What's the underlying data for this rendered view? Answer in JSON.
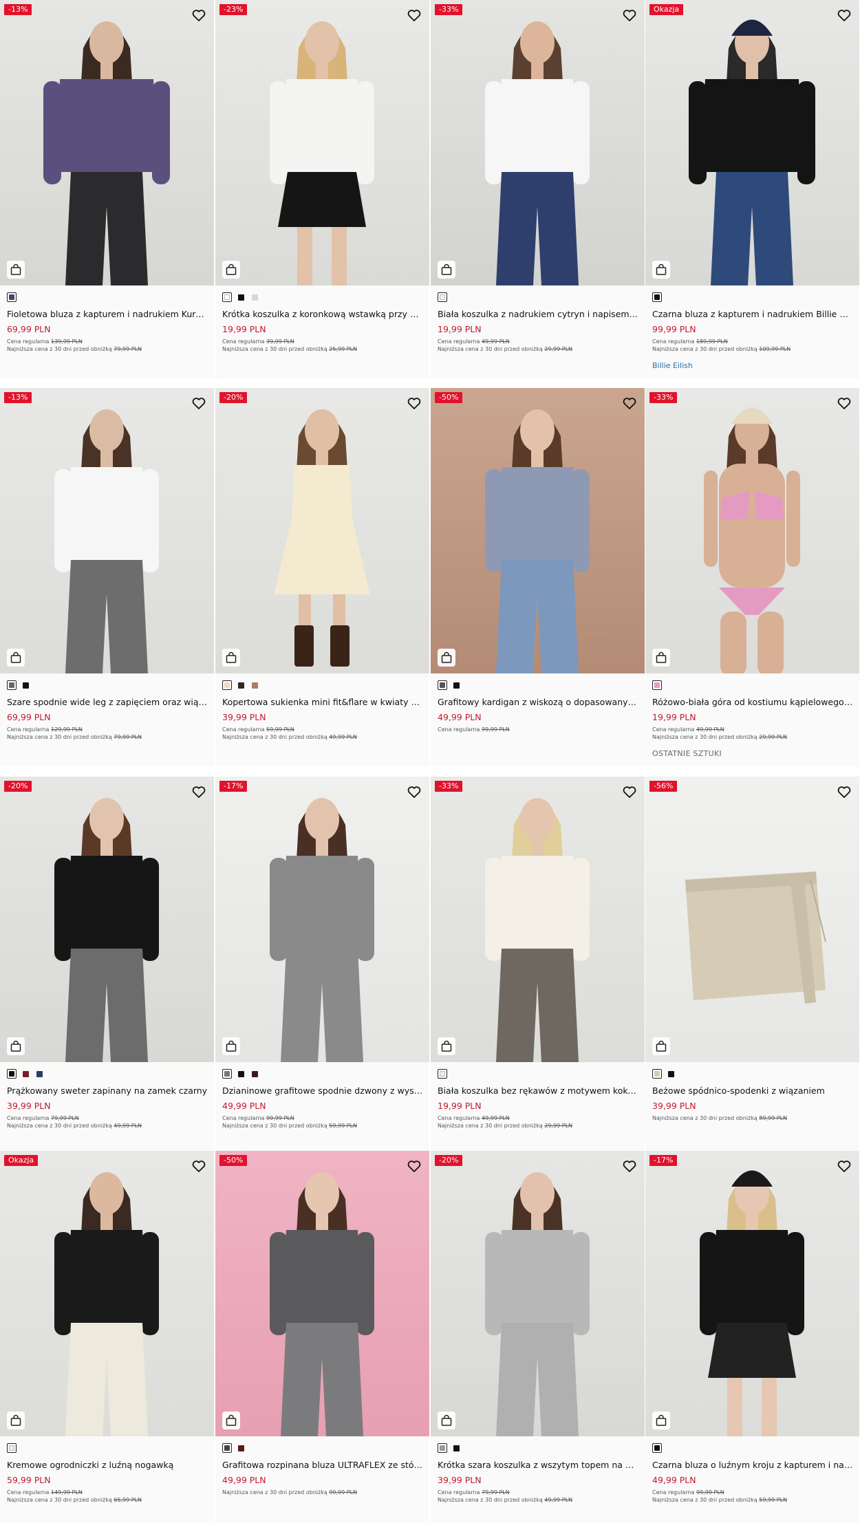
{
  "colors": {
    "badge_discount": "#e1122b",
    "badge_sale": "#e1122b",
    "price": "#c4192c",
    "link": "#2b6ea3"
  },
  "labels": {
    "regular": "Cena regularna",
    "lowest": "Najniższa cena z 30 dni przed obniżką"
  },
  "products": [
    {
      "badge": "-13%",
      "name": "Fioletowa bluza z kapturem i nadrukiem Kuromi",
      "price": "69,99 PLN",
      "regular": "139,99 PLN",
      "lowest": "79,99 PLN",
      "swatches": [
        "#4a4270"
      ],
      "bg": [
        "#e6e6e4",
        "#d6d6d3"
      ],
      "top": "#5b4f7e",
      "bottom": "#2b2b2d",
      "skin": "#d9b8a0",
      "hair": "#3a2a22",
      "hat": "",
      "style": "hoodie"
    },
    {
      "badge": "-23%",
      "name": "Krótka koszulka z koronkową wstawką przy dekolcie",
      "price": "19,99 PLN",
      "regular": "39,99 PLN",
      "lowest": "25,99 PLN",
      "swatches": [
        "#ffffff",
        "#111111",
        "#d7d7d7"
      ],
      "bg": [
        "#e9e9e7",
        "#dadad7"
      ],
      "top": "#f4f4f2",
      "bottom": "#151515",
      "skin": "#e2c2a8",
      "hair": "#d8b37a",
      "hat": "",
      "style": "skirt"
    },
    {
      "badge": "-33%",
      "name": "Biała koszulka z nadrukiem cytryn i napisem Sunny Mood",
      "price": "19,99 PLN",
      "regular": "49,99 PLN",
      "lowest": "29,99 PLN",
      "swatches": [
        "#eeeeff"
      ],
      "bg": [
        "#e4e4e2",
        "#d2d2cf"
      ],
      "top": "#f6f6f6",
      "bottom": "#2e3f6e",
      "skin": "#dcb59a",
      "hair": "#5a4030",
      "hat": "",
      "style": "plaid"
    },
    {
      "badge": "Okazja",
      "name": "Czarna bluza z kapturem i nadrukiem Billie Eilish",
      "price": "99,99 PLN",
      "regular": "189,99 PLN",
      "lowest": "109,99 PLN",
      "swatches": [
        "#111111"
      ],
      "bg": [
        "#e7e7e5",
        "#d8d8d5"
      ],
      "top": "#141414",
      "bottom": "#2e4a7a",
      "skin": "#e0c0a8",
      "hair": "#2a2a2a",
      "hat": "#1d2540",
      "style": "hoodie",
      "tag": "Billie Eilish"
    },
    {
      "badge": "-13%",
      "name": "Szare spodnie wide leg z zapięciem oraz wiązaniem",
      "price": "69,99 PLN",
      "regular": "129,99 PLN",
      "lowest": "79,99 PLN",
      "swatches": [
        "#666666",
        "#111111"
      ],
      "bg": [
        "#e8e8e6",
        "#dcdcd9"
      ],
      "top": "#f6f6f6",
      "bottom": "#6d6d6d",
      "skin": "#dcbba4",
      "hair": "#4a3226",
      "hat": "",
      "style": "pants"
    },
    {
      "badge": "-20%",
      "name": "Kopertowa sukienka mini fit&flare w kwiaty z krótkim rękawem",
      "price": "39,99 PLN",
      "regular": "59,99 PLN",
      "lowest": "49,99 PLN",
      "swatches": [
        "#e9dcc0",
        "#2d2a26",
        "#b07a6a"
      ],
      "bg": [
        "#e8e8e6",
        "#dcdcd9"
      ],
      "top": "#f3ead0",
      "bottom": "#f3ead0",
      "skin": "#e0bfa4",
      "hair": "#6a4a30",
      "hat": "",
      "style": "dress"
    },
    {
      "badge": "-50%",
      "name": "Grafitowy kardigan z wiskozą o dopasowanym kroju",
      "price": "49,99 PLN",
      "regular": "99,99 PLN",
      "lowest": "",
      "swatches": [
        "#555555",
        "#111111"
      ],
      "bg": [
        "#caa58f",
        "#b48c76"
      ],
      "top": "#8e9ab4",
      "bottom": "#7d98bd",
      "skin": "#e4c2aa",
      "hair": "#5a3a28",
      "hat": "",
      "style": "pants"
    },
    {
      "badge": "-33%",
      "name": "Różowo-biała góra od kostiumu kąpielowego w paski",
      "price": "19,99 PLN",
      "regular": "49,99 PLN",
      "lowest": "29,99 PLN",
      "swatches": [
        "#e59ac2"
      ],
      "bg": [
        "#e8e8e6",
        "#dcdcd9"
      ],
      "top": "#e59ac2",
      "bottom": "#e59ac2",
      "skin": "#d8b096",
      "hair": "#5a3a28",
      "hat": "#e5d9bf",
      "style": "bikini",
      "tag_grey": "OSTATNIE SZTUKI"
    },
    {
      "badge": "-20%",
      "name": "Prążkowany sweter zapinany na zamek czarny",
      "price": "39,99 PLN",
      "regular": "79,99 PLN",
      "lowest": "49,99 PLN",
      "swatches": [
        "#111111",
        "#7a1f2a",
        "#2d3d5e"
      ],
      "bg": [
        "#e6e6e4",
        "#d8d8d5"
      ],
      "top": "#161616",
      "bottom": "#6c6c6c",
      "skin": "#e2c4ae",
      "hair": "#5a3a26",
      "hat": "",
      "style": "pants"
    },
    {
      "badge": "-17%",
      "name": "Dzianinowe grafitowe spodnie dzwony z wysokim stanem",
      "price": "49,99 PLN",
      "regular": "99,99 PLN",
      "lowest": "59,99 PLN",
      "swatches": [
        "#777777",
        "#111111",
        "#3b1d1d"
      ],
      "bg": [
        "#f0f0ee",
        "#e4e4e2"
      ],
      "top": "#8a8a8a",
      "bottom": "#8a8a8a",
      "skin": "#e2c4ae",
      "hair": "#4a3024",
      "hat": "",
      "style": "pants"
    },
    {
      "badge": "-33%",
      "name": "Biała koszulka bez rękawów z motywem kokardek",
      "price": "19,99 PLN",
      "regular": "49,99 PLN",
      "lowest": "29,99 PLN",
      "swatches": [
        "#eeeeee"
      ],
      "bg": [
        "#e8e8e6",
        "#dcdcd9"
      ],
      "top": "#f4f0e8",
      "bottom": "#6e6860",
      "skin": "#e4c6ae",
      "hair": "#e0cf9a",
      "hat": "",
      "style": "pants"
    },
    {
      "badge": "-56%",
      "name": "Beżowe spódnico-spodenki z wiązaniem",
      "price": "39,99 PLN",
      "regular": "",
      "lowest": "89,99 PLN",
      "swatches": [
        "#d6ccb6",
        "#111111"
      ],
      "bg": [
        "#f1f1ef",
        "#e6e6e4"
      ],
      "top": "",
      "bottom": "#d6ccb6",
      "skin": "",
      "hair": "",
      "hat": "",
      "style": "flat"
    },
    {
      "badge": "Okazja",
      "name": "Kremowe ogrodniczki z luźną nogawką",
      "price": "59,99 PLN",
      "regular": "149,99 PLN",
      "lowest": "65,99 PLN",
      "swatches": [
        "#efeadf"
      ],
      "bg": [
        "#e8e8e6",
        "#dcdcd9"
      ],
      "top": "#1a1a1a",
      "bottom": "#eee9dd",
      "skin": "#dcb89e",
      "hair": "#3a2a22",
      "hat": "",
      "style": "pants"
    },
    {
      "badge": "-50%",
      "name": "Grafitowa rozpinana bluza ULTRAFLEX ze stójką",
      "price": "49,99 PLN",
      "regular": "",
      "lowest": "99,99 PLN",
      "swatches": [
        "#444444",
        "#5a1a1a"
      ],
      "bg": [
        "#f0b4c4",
        "#e79fb3"
      ],
      "top": "#5a5a5c",
      "bottom": "#7b7a7c",
      "skin": "#e6c6b0",
      "hair": "#4a3024",
      "hat": "",
      "style": "pants"
    },
    {
      "badge": "-20%",
      "name": "Krótka szara koszulka z wszytym topem na ko...",
      "price": "39,99 PLN",
      "regular": "79,99 PLN",
      "lowest": "49,99 PLN",
      "swatches": [
        "#999999",
        "#111111"
      ],
      "bg": [
        "#e6e6e4",
        "#d8d8d5"
      ],
      "top": "#b8b8b8",
      "bottom": "#b0b0b0",
      "skin": "#e2c2ac",
      "hair": "#4a3226",
      "hat": "",
      "style": "pants"
    },
    {
      "badge": "-17%",
      "name": "Czarna bluza o luźnym kroju z kapturem i napisami",
      "price": "49,99 PLN",
      "regular": "99,99 PLN",
      "lowest": "59,99 PLN",
      "swatches": [
        "#111111"
      ],
      "bg": [
        "#e8e8e6",
        "#dcdcd9"
      ],
      "top": "#151515",
      "bottom": "#222222",
      "skin": "#e6c8b2",
      "hair": "#d9c08a",
      "hat": "#1a1a1a",
      "style": "skirt"
    }
  ]
}
